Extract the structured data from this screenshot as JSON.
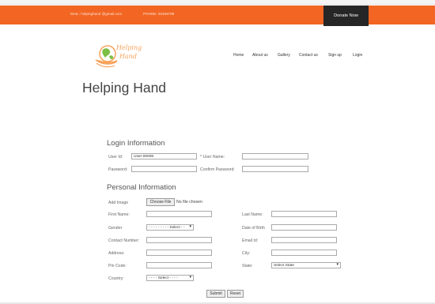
{
  "topbar": {
    "mail": "MAIL: helpinghand @gmail.com",
    "phone": "PHONE: 02466788",
    "donate_label": "Donate Now"
  },
  "logo": {
    "line1": "Helping",
    "line2": "Hand"
  },
  "nav": [
    "Home",
    "About us",
    "Gallery",
    "Contact us",
    "Sign up",
    "Login"
  ],
  "page_title": "Helping Hand",
  "login": {
    "heading": "Login Information",
    "userid_label": "User Id:",
    "userid_value": "User-00008",
    "username_label": "* User Name:",
    "password_label": "Password:",
    "confirm_label": "Confirm Password:"
  },
  "personal": {
    "heading": "Personal Information",
    "add_image_label": "Add Image",
    "choose_file": "Choose File",
    "no_file": "No file chosen",
    "first_name_label": "First Name:",
    "last_name_label": "Last Name:",
    "gender_label": "Gender",
    "gender_value": "- - - - - - - - - Select - -",
    "dob_label": "Date of Birth",
    "contact_label": "Contact Number:",
    "email_label": "Email Id:",
    "address_label": "Address:",
    "city_label": "City:",
    "pin_label": "Pin Code:",
    "state_label": "State:",
    "state_value": "Select State",
    "country_label": "Country:",
    "country_value": "- - - - Select - - - -"
  },
  "actions": {
    "submit": "Submit",
    "reset": "Reset"
  },
  "colors": {
    "accent": "#f26522",
    "donate_bg": "#262626",
    "logo": "#f7a35c"
  }
}
